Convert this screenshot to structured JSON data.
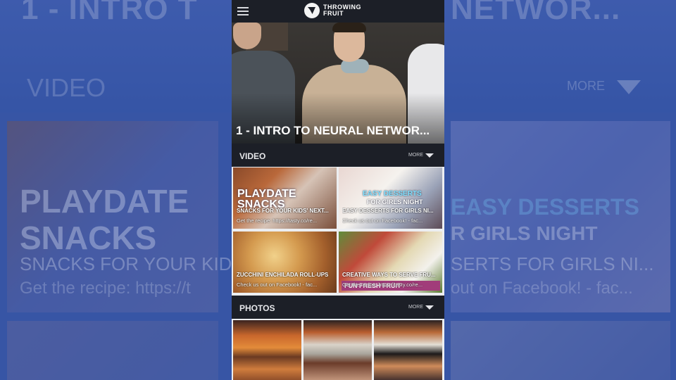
{
  "background": {
    "title_left": "1 - INTRO T",
    "title_right": "NETWOR...",
    "video_label": "VIDEO",
    "more_label": "MORE",
    "playdate_line1": "PLAYDATE",
    "playdate_line2": "SNACKS",
    "snacks_text": "SNACKS FOR YOUR KID",
    "recipe_text": "Get the recipe: https://t",
    "easy_text": "EASY DESSERTS",
    "girls_text": "R GIRLS NIGHT",
    "desserts_text": "SERTS FOR GIRLS NI...",
    "facebook_text": "out on Facebook! - fac..."
  },
  "app": {
    "logo_line1": "THROWING",
    "logo_line2": "FRUIT"
  },
  "hero": {
    "title": "1 - INTRO TO NEURAL NETWOR..."
  },
  "video_section": {
    "label": "VIDEO",
    "more_label": "MORE",
    "tiles": [
      {
        "overlay_line1": "PLAYDATE",
        "overlay_line2": "SNACKS",
        "title": "SNACKS FOR YOUR KIDS' NEXT...",
        "desc": "Get the recipe: https://tasty.co/re..."
      },
      {
        "overlay_line1": "EASY DESSERTS",
        "overlay_line2": "FOR GIRLS NIGHT",
        "title": "EASY DESSERTS FOR GIRLS NI...",
        "desc": "Check us out on Facebook! - fac..."
      },
      {
        "title": "ZUCCHINI ENCHILADA ROLL-UPS",
        "desc": "Check us out on Facebook! - fac..."
      },
      {
        "tag": "FUN FRESH FRUIT",
        "title": "CREATIVE WAYS TO SERVE FRU...",
        "desc": "Get the recipe: https://tasty.co/re..."
      }
    ]
  },
  "photos_section": {
    "label": "PHOTOS",
    "more_label": "MORE"
  }
}
